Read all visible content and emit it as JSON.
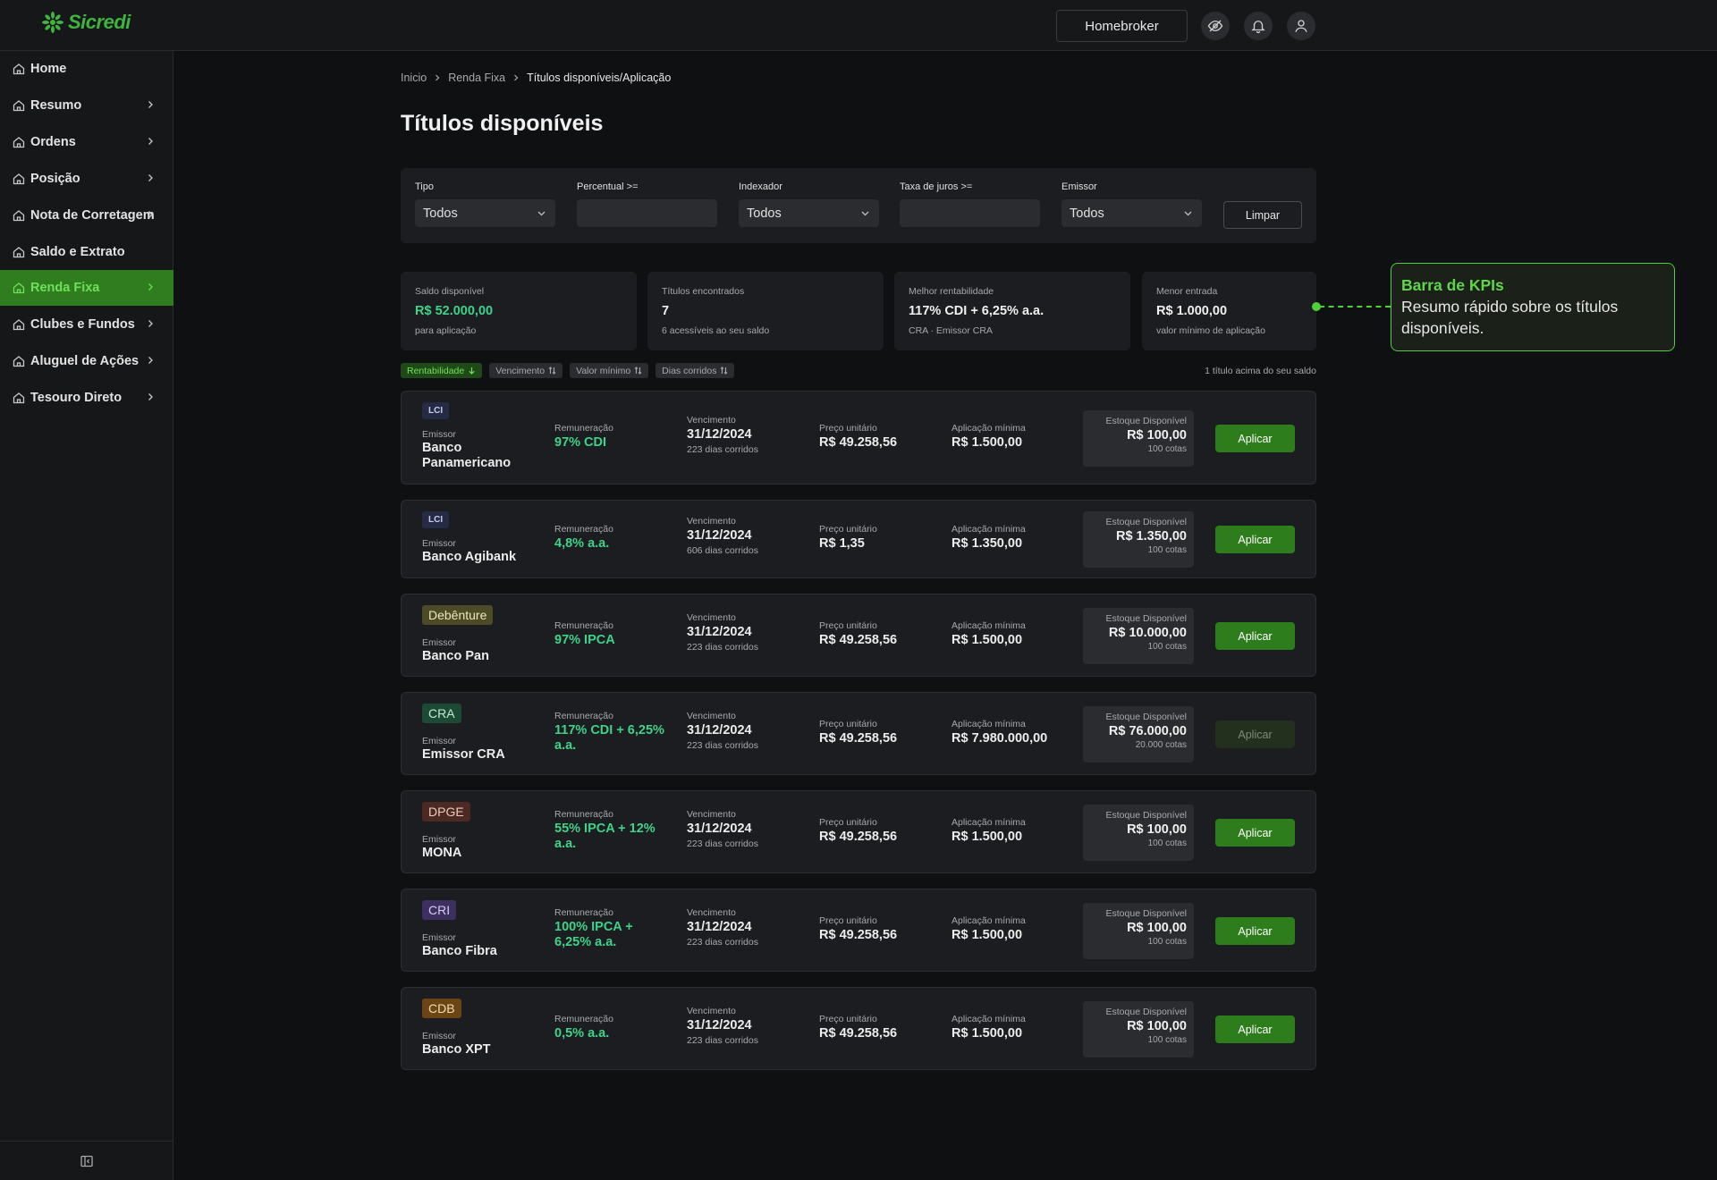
{
  "header": {
    "logo_text": "Sicredi",
    "homebroker_label": "Homebroker",
    "icons": [
      "eye-off-icon",
      "bell-icon",
      "user-icon"
    ]
  },
  "sidebar": {
    "items": [
      {
        "label": "Home",
        "icon": "home-icon",
        "chevron": false,
        "active": false
      },
      {
        "label": "Resumo",
        "icon": "home-icon",
        "chevron": true,
        "active": false
      },
      {
        "label": "Ordens",
        "icon": "home-icon",
        "chevron": true,
        "active": false
      },
      {
        "label": "Posição",
        "icon": "home-icon",
        "chevron": true,
        "active": false
      },
      {
        "label": "Nota de Corretagem",
        "icon": "home-icon",
        "chevron": true,
        "active": false
      },
      {
        "label": "Saldo e Extrato",
        "icon": "home-icon",
        "chevron": false,
        "active": false
      },
      {
        "label": "Renda Fixa",
        "icon": "home-icon",
        "chevron": true,
        "active": true
      },
      {
        "label": "Clubes e Fundos",
        "icon": "home-icon",
        "chevron": true,
        "active": false
      },
      {
        "label": "Aluguel de Ações",
        "icon": "home-icon",
        "chevron": true,
        "active": false
      },
      {
        "label": "Tesouro Direto",
        "icon": "home-icon",
        "chevron": true,
        "active": false
      }
    ],
    "collapse_icon": "sidebar-collapse-icon"
  },
  "breadcrumb": [
    "Inicio",
    "Renda Fixa",
    "Títulos disponíveis/Aplicação"
  ],
  "page_title": "Títulos disponíveis",
  "filters": {
    "tipo": {
      "label": "Tipo",
      "value": "Todos"
    },
    "percentual": {
      "label": "Percentual >=",
      "value": ""
    },
    "indexador": {
      "label": "Indexador",
      "value": "Todos"
    },
    "taxa": {
      "label": "Taxa de juros >=",
      "value": ""
    },
    "emissor": {
      "label": "Emissor",
      "value": "Todos"
    },
    "clear_label": "Limpar"
  },
  "kpis": [
    {
      "label": "Saldo disponível",
      "value": "R$ 52.000,00",
      "sub": "para aplicação",
      "highlight": true
    },
    {
      "label": "Títulos encontrados",
      "value": "7",
      "sub": "6 acessíveis ao seu saldo",
      "highlight": false
    },
    {
      "label": "Melhor rentabilidade",
      "value": "117% CDI + 6,25% a.a.",
      "sub": "CRA · Emissor CRA",
      "highlight": false
    },
    {
      "label": "Menor entrada",
      "value": "R$ 1.000,00",
      "sub": "valor mínimo de aplicação",
      "highlight": false
    }
  ],
  "callout": {
    "title": "Barra de KPIs",
    "text": "Resumo rápido sobre os títulos disponíveis."
  },
  "sort": {
    "chips": [
      {
        "label": "Rentabilidade",
        "active": true
      },
      {
        "label": "Vencimento",
        "active": false
      },
      {
        "label": "Valor mínimo",
        "active": false
      },
      {
        "label": "Dias corridos",
        "active": false
      }
    ],
    "note": "1 título acima do seu saldo"
  },
  "labels": {
    "emissor": "Emissor",
    "remuneracao": "Remuneração",
    "vencimento": "Vencimento",
    "preco": "Preço unitário",
    "aplicacao": "Aplicação mínima",
    "estoque": "Estoque Disponível",
    "apply": "Aplicar"
  },
  "titles": [
    {
      "type": "LCI",
      "badge_bg": "#262b45",
      "badge_fg": "#c8ccf0",
      "small": true,
      "emissor": "Banco Panamericano",
      "remuneracao": "97% CDI",
      "vencimento": "31/12/2024",
      "dias": "223 dias corridos",
      "preco": "R$ 49.258,56",
      "aplicacao": "R$ 1.500,00",
      "estoque": "R$ 100,00",
      "cotas": "100 cotas",
      "enabled": true
    },
    {
      "type": "LCI",
      "badge_bg": "#262b45",
      "badge_fg": "#c8ccf0",
      "small": true,
      "emissor": "Banco Agibank",
      "remuneracao": "4,8% a.a.",
      "vencimento": "31/12/2024",
      "dias": "606 dias corridos",
      "preco": "R$ 1,35",
      "aplicacao": "R$ 1.350,00",
      "estoque": "R$ 1.350,00",
      "cotas": "100 cotas",
      "enabled": true
    },
    {
      "type": "Debênture",
      "badge_bg": "#4d4a27",
      "badge_fg": "#ece7b8",
      "small": false,
      "emissor": "Banco Pan",
      "remuneracao": "97% IPCA",
      "vencimento": "31/12/2024",
      "dias": "223 dias corridos",
      "preco": "R$ 49.258,56",
      "aplicacao": "R$ 1.500,00",
      "estoque": "R$ 10.000,00",
      "cotas": "100 cotas",
      "enabled": true
    },
    {
      "type": "CRA",
      "badge_bg": "#1d4a35",
      "badge_fg": "#bdebd4",
      "small": false,
      "emissor": "Emissor CRA",
      "remuneracao": "117% CDI + 6,25% a.a.",
      "vencimento": "31/12/2024",
      "dias": "223 dias corridos",
      "preco": "R$ 49.258,56",
      "aplicacao": "R$ 7.980.000,00",
      "estoque": "R$ 76.000,00",
      "cotas": "20.000 cotas",
      "enabled": false
    },
    {
      "type": "DPGE",
      "badge_bg": "#4a2a22",
      "badge_fg": "#efc9bd",
      "small": false,
      "emissor": "MONA",
      "remuneracao": "55% IPCA + 12% a.a.",
      "vencimento": "31/12/2024",
      "dias": "223 dias corridos",
      "preco": "R$ 49.258,56",
      "aplicacao": "R$ 1.500,00",
      "estoque": "R$ 100,00",
      "cotas": "100 cotas",
      "enabled": true
    },
    {
      "type": "CRI",
      "badge_bg": "#3d2f5e",
      "badge_fg": "#d8cdf5",
      "small": false,
      "emissor": "Banco Fibra",
      "remuneracao": "100% IPCA + 6,25% a.a.",
      "vencimento": "31/12/2024",
      "dias": "223 dias corridos",
      "preco": "R$ 49.258,56",
      "aplicacao": "R$ 1.500,00",
      "estoque": "R$ 100,00",
      "cotas": "100 cotas",
      "enabled": true
    },
    {
      "type": "CDB",
      "badge_bg": "#6b4614",
      "badge_fg": "#f3dcb1",
      "small": false,
      "emissor": "Banco XPT",
      "remuneracao": "0,5% a.a.",
      "vencimento": "31/12/2024",
      "dias": "223 dias corridos",
      "preco": "R$ 49.258,56",
      "aplicacao": "R$ 1.500,00",
      "estoque": "R$ 100,00",
      "cotas": "100 cotas",
      "enabled": true
    }
  ],
  "colors": {
    "accent": "#3fb43f",
    "positive": "#3fd28a",
    "apply_button": "#2e7d1c"
  }
}
